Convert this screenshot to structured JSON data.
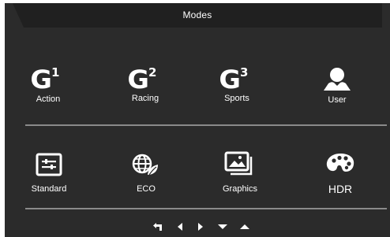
{
  "title": "Modes",
  "modes_row1": [
    {
      "label": "Action",
      "icon": "g1-icon",
      "digit": "1"
    },
    {
      "label": "Racing",
      "icon": "g2-icon",
      "digit": "2"
    },
    {
      "label": "Sports",
      "icon": "g3-icon",
      "digit": "3"
    },
    {
      "label": "User",
      "icon": "user-icon"
    }
  ],
  "modes_row2": [
    {
      "label": "Standard",
      "icon": "standard-sliders-icon"
    },
    {
      "label": "ECO",
      "icon": "eco-globe-leaf-icon"
    },
    {
      "label": "Graphics",
      "icon": "graphics-picture-icon"
    },
    {
      "label": "HDR",
      "icon": "palette-icon"
    }
  ],
  "nav": [
    "return-icon",
    "left-arrow-icon",
    "right-arrow-icon",
    "down-arrow-icon",
    "up-arrow-icon"
  ],
  "colors": {
    "panel": "#2b2b2b",
    "title_bar": "#202020",
    "text": "#ffffff",
    "divider": "#8a8a8a"
  }
}
